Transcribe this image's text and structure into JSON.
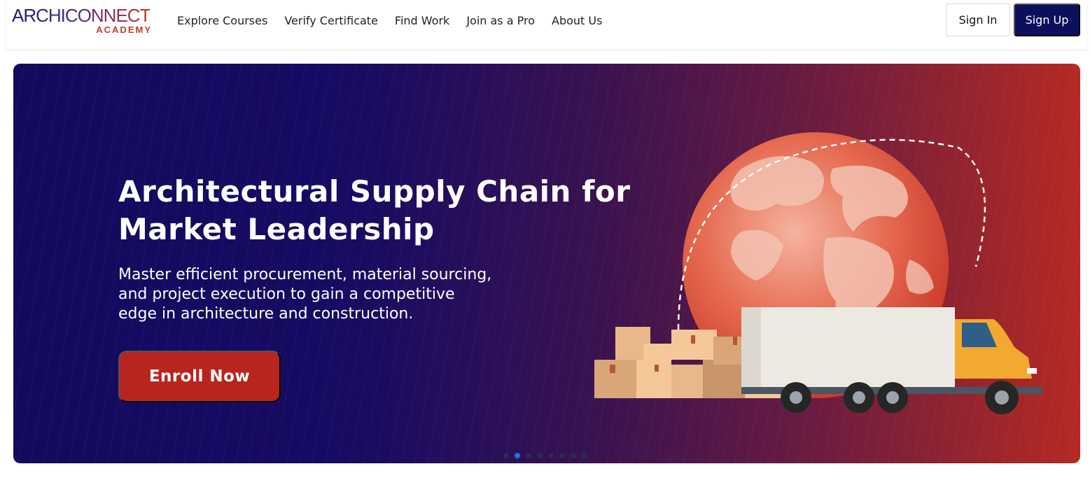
{
  "logo": {
    "main": "ARCHICONNECT",
    "sub": "ACADEMY"
  },
  "nav": {
    "links": [
      "Explore Courses",
      "Verify Certificate",
      "Find Work",
      "Join as a Pro",
      "About Us"
    ],
    "sign_in": "Sign In",
    "sign_up": "Sign Up"
  },
  "hero": {
    "title_line1": "Architectural Supply Chain for",
    "title_line2": "Market Leadership",
    "subtitle_line1": "Master efficient procurement, material sourcing,",
    "subtitle_line2": "and project execution to gain a competitive",
    "subtitle_line3": "edge in architecture and construction.",
    "cta": "Enroll Now"
  },
  "carousel": {
    "slide_count": 8,
    "active_index": 1
  },
  "colors": {
    "brand_navy": "#0b0f5c",
    "cta_red": "#b8251e",
    "dot_active": "#1a73e8"
  }
}
